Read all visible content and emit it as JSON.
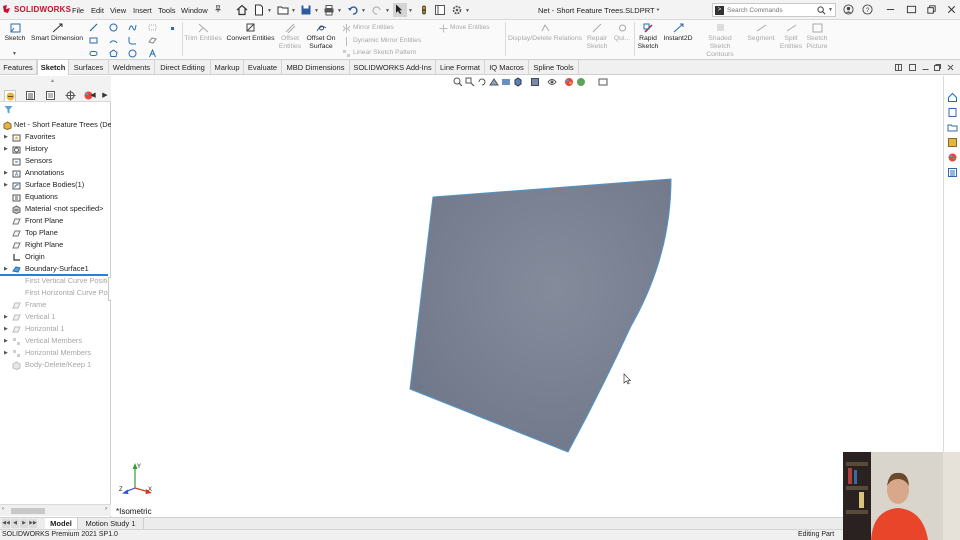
{
  "titlebar": {
    "logo_text": "SOLIDWORKS",
    "menus": [
      "File",
      "Edit",
      "View",
      "Insert",
      "Tools",
      "Window"
    ],
    "document_title": "Net - Short Feature Trees.SLDPRT *",
    "search_placeholder": "Search Commands"
  },
  "command_manager": {
    "sketch": "Sketch",
    "smart_dimension": "Smart Dimension",
    "trim_entities": "Trim Entities",
    "convert_entities": "Convert Entities",
    "offset_entities": [
      "Offset",
      "Entities"
    ],
    "offset_on_surface": [
      "Offset On",
      "Surface"
    ],
    "mirror_entities": "Mirror Entities",
    "dynamic_mirror_entities": "Dynamic Mirror Entities",
    "linear_sketch_pattern": "Linear Sketch Pattern",
    "move_entities": "Move Entities",
    "display_delete_relations": "Display/Delete Relations",
    "repair_sketch": [
      "Repair",
      "Sketch"
    ],
    "quick_snaps": "Qui...",
    "rapid_sketch": [
      "Rapid",
      "Sketch"
    ],
    "instant2d": "Instant2D",
    "shaded_sketch_contours": [
      "Shaded Sketch",
      "Contours"
    ],
    "segment": "Segment",
    "split_entities": [
      "Split",
      "Entities"
    ],
    "sketch_picture": [
      "Sketch",
      "Picture"
    ]
  },
  "tabs": [
    "Features",
    "Sketch",
    "Surfaces",
    "Weldments",
    "Direct Editing",
    "Markup",
    "Evaluate",
    "MBD Dimensions",
    "SOLIDWORKS Add-Ins",
    "Line Format",
    "IQ Macros",
    "Spline Tools"
  ],
  "active_tab": "Sketch",
  "feature_tree": {
    "root": "Net - Short Feature Trees  (De",
    "items": [
      {
        "label": "Favorites",
        "icon": "star-folder-icon",
        "expandable": true,
        "state": "normal"
      },
      {
        "label": "History",
        "icon": "history-icon",
        "expandable": true,
        "state": "normal"
      },
      {
        "label": "Sensors",
        "icon": "sensor-icon",
        "expandable": false,
        "state": "normal"
      },
      {
        "label": "Annotations",
        "icon": "annotation-icon",
        "expandable": true,
        "state": "normal"
      },
      {
        "label": "Surface Bodies(1)",
        "icon": "surface-bodies-icon",
        "expandable": true,
        "state": "normal"
      },
      {
        "label": "Equations",
        "icon": "equations-icon",
        "expandable": false,
        "state": "normal"
      },
      {
        "label": "Material <not specified>",
        "icon": "material-icon",
        "expandable": false,
        "state": "normal"
      },
      {
        "label": "Front Plane",
        "icon": "plane-icon",
        "expandable": false,
        "state": "normal"
      },
      {
        "label": "Top Plane",
        "icon": "plane-icon",
        "expandable": false,
        "state": "normal"
      },
      {
        "label": "Right Plane",
        "icon": "plane-icon",
        "expandable": false,
        "state": "normal"
      },
      {
        "label": "Origin",
        "icon": "origin-icon",
        "expandable": false,
        "state": "normal"
      },
      {
        "label": "Boundary-Surface1",
        "icon": "boundary-surface-icon",
        "expandable": true,
        "state": "selected"
      },
      {
        "label": "First Vertical Curve Positio",
        "icon": "",
        "expandable": false,
        "state": "suppressed"
      },
      {
        "label": "First Horizontal Curve Pos",
        "icon": "",
        "expandable": false,
        "state": "suppressed"
      },
      {
        "label": "Frame",
        "icon": "sketch-icon",
        "expandable": false,
        "state": "suppressed"
      },
      {
        "label": "Vertical 1",
        "icon": "sketch-icon",
        "expandable": true,
        "state": "suppressed"
      },
      {
        "label": "Horizontal 1",
        "icon": "sketch-icon",
        "expandable": true,
        "state": "suppressed"
      },
      {
        "label": "Vertical Members",
        "icon": "pattern-icon",
        "expandable": true,
        "state": "suppressed"
      },
      {
        "label": "Horizontal Members",
        "icon": "pattern-icon",
        "expandable": true,
        "state": "suppressed"
      },
      {
        "label": "Body-Delete/Keep 1",
        "icon": "body-delete-icon",
        "expandable": false,
        "state": "suppressed"
      }
    ]
  },
  "viewport": {
    "view_orientation": "*Isometric",
    "triad_labels": {
      "x": "X",
      "y": "Y",
      "z": "Z"
    },
    "surface_color": "#7a8394"
  },
  "bottom_tabs": [
    "Model",
    "Motion Study 1"
  ],
  "active_bottom_tab": "Model",
  "status": {
    "left": "SOLIDWORKS Premium 2021 SP1.0",
    "right": "Editing Part"
  },
  "colors": {
    "brand_red": "#c8102e",
    "selection_blue": "#2b7fd1",
    "suppressed_grey": "#a6a6a6"
  }
}
